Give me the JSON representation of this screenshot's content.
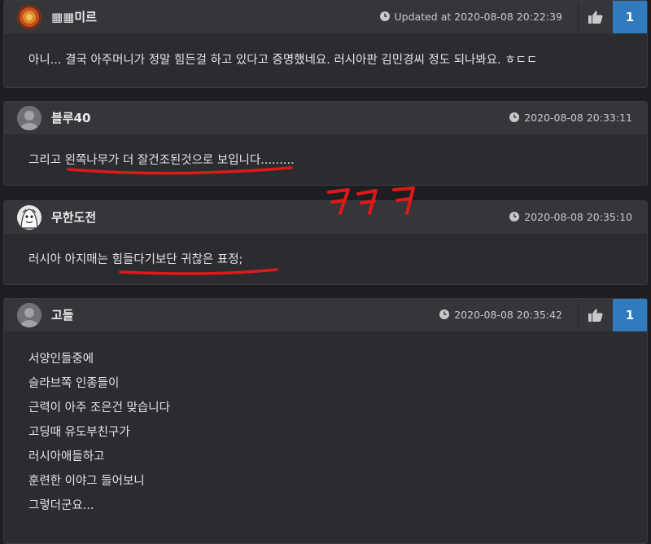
{
  "comments": [
    {
      "author": "▦▦미르",
      "time": "Updated at 2020-08-08 20:22:39",
      "likes": "1",
      "lines": [
        "아니... 결국 아주머니가 정말 힘든걸 하고 있다고 증명했네요. 러시아판 김민경씨 정도 되나봐요. ㅎㄷㄷ"
      ]
    },
    {
      "author": "블루40",
      "time": "2020-08-08 20:33:11",
      "lines": [
        "그리고 왼쪽나무가 더 잘건조된것으로 보입니다........."
      ]
    },
    {
      "author": "무한도전",
      "time": "2020-08-08 20:35:10",
      "lines": [
        "러시아 아지매는 힘들다기보단 귀찮은 표정;"
      ]
    },
    {
      "author": "고돌",
      "time": "2020-08-08 20:35:42",
      "likes": "1",
      "lines": [
        "서양인들중에",
        "슬라브쪽 인종들이",
        "근력이 아주 조은건 맞습니다",
        "고딩때 유도부친구가",
        "러시아애들하고",
        "훈련한  이야그 들어보니",
        "그렇더군요..."
      ]
    }
  ],
  "icons": {
    "time": "clock-icon",
    "like": "thumbs-up-icon"
  },
  "colors": {
    "accent": "#2f7bbd",
    "annotation": "#e01818"
  }
}
